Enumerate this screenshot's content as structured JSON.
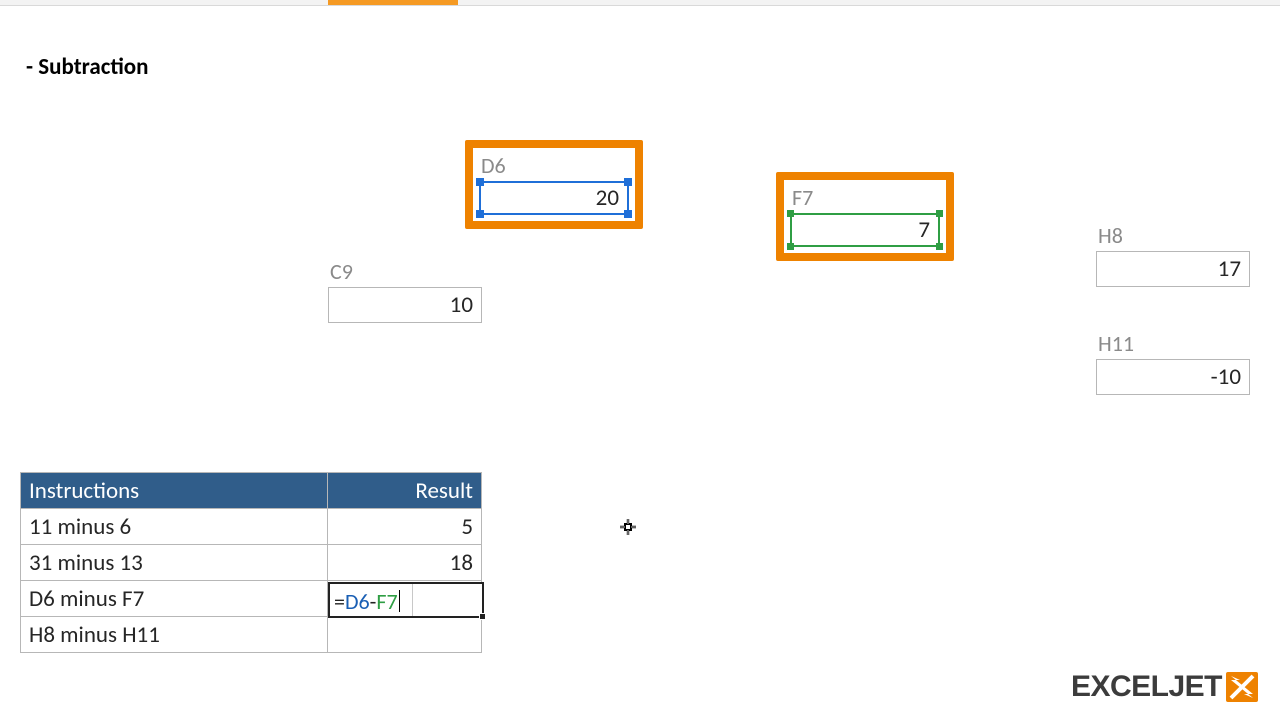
{
  "title": "- Subtraction",
  "cells": {
    "D6": {
      "label": "D6",
      "value": "20"
    },
    "F7": {
      "label": "F7",
      "value": "7"
    },
    "C9": {
      "label": "C9",
      "value": "10"
    },
    "H8": {
      "label": "H8",
      "value": "17"
    },
    "H11": {
      "label": "H11",
      "value": "-10"
    }
  },
  "table": {
    "headers": {
      "instructions": "Instructions",
      "result": "Result"
    },
    "rows": [
      {
        "instr": "11 minus 6",
        "result": "5"
      },
      {
        "instr": "31 minus 13",
        "result": "18"
      },
      {
        "instr": "D6 minus F7",
        "result": ""
      },
      {
        "instr": "H8 minus H11",
        "result": ""
      }
    ]
  },
  "editing_formula": {
    "eq": "=",
    "ref1": "D6",
    "op": "-",
    "ref2": "F7"
  },
  "logo": {
    "text": "EXCELJET"
  }
}
